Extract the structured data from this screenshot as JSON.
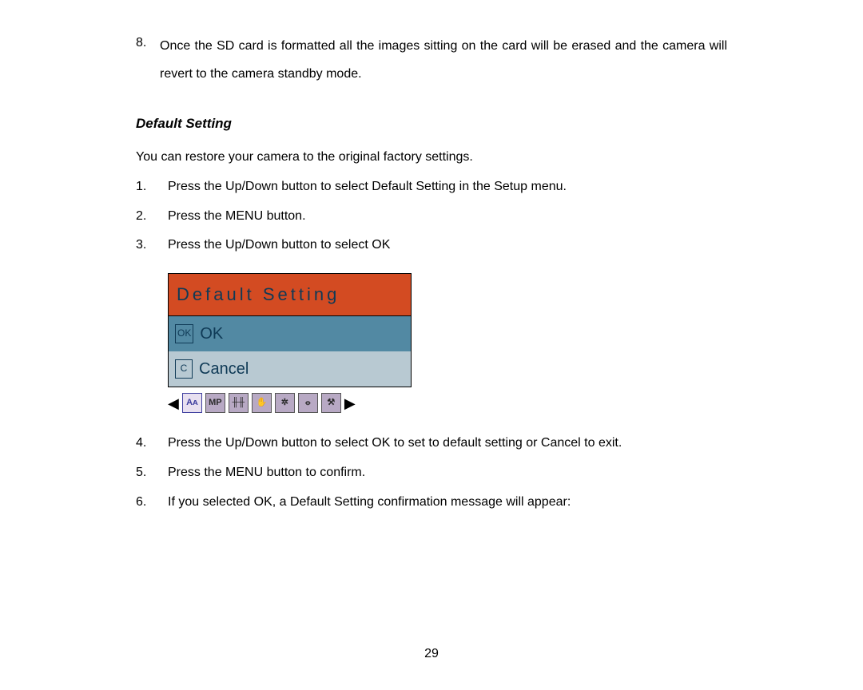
{
  "topItem": {
    "number": "8.",
    "text": "Once the SD card is formatted all the images sitting on the card will be erased and the camera will revert to the camera standby mode."
  },
  "section": {
    "heading": "Default Setting",
    "intro": "You can restore your camera to the original factory settings.",
    "steps_before": [
      {
        "num": "1.",
        "text": "Press the Up/Down button to select Default Setting in the Setup menu."
      },
      {
        "num": "2.",
        "text": "Press the MENU button."
      },
      {
        "num": "3.",
        "text": "Press the Up/Down button to select OK"
      }
    ],
    "steps_after": [
      {
        "num": "4.",
        "text": "Press the Up/Down button to select OK to set to default setting or Cancel to exit."
      },
      {
        "num": "5.",
        "text": "Press the MENU button to confirm."
      },
      {
        "num": "6.",
        "text": "If you selected OK, a Default Setting confirmation message will appear:"
      }
    ]
  },
  "cameraScreen": {
    "title": "Default Setting",
    "options": {
      "ok": {
        "iconText": "OK",
        "label": "OK"
      },
      "cancel": {
        "iconText": "C",
        "label": "Cancel"
      }
    },
    "stripIcons": {
      "a": "Aᴀ",
      "mp": "MP",
      "frequency": "╫╫",
      "hand": "✋",
      "face": "✲",
      "timer": "⦵",
      "wrench": "⚒"
    }
  },
  "pageNumber": "29"
}
